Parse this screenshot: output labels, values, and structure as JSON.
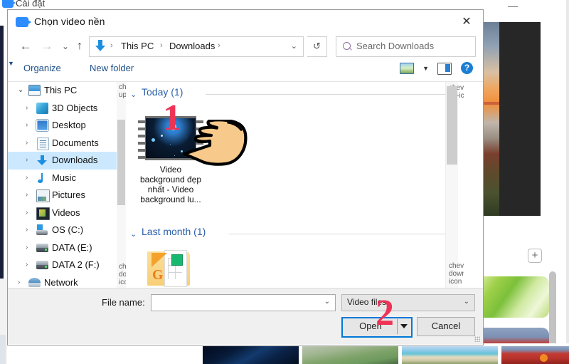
{
  "background_window": {
    "title": "Cài đặt",
    "title_icon": "zoom-video-icon",
    "minimize_label": "—",
    "popout_icon": "popout-icon",
    "add_icon": "plus-icon",
    "thumbnails": [
      {
        "name": "virtual-background-space"
      },
      {
        "name": "virtual-background-aurora"
      },
      {
        "name": "virtual-background-beach"
      },
      {
        "name": "virtual-background-team"
      },
      {
        "name": "virtual-background-grass"
      },
      {
        "name": "virtual-background-soccer-team"
      }
    ]
  },
  "dialog": {
    "title": "Chọn video nền",
    "title_icon": "zoom-video-icon",
    "close_label": "✕",
    "nav": {
      "back_icon": "arrow-left-icon",
      "forward_icon": "arrow-right-icon",
      "recent_icon": "chevron-down-icon",
      "up_icon": "arrow-up-icon",
      "refresh_icon": "refresh-icon",
      "address_icon": "downloads-icon",
      "breadcrumbs": [
        "This PC",
        "Downloads"
      ],
      "breadcrumb_separator": "›",
      "address_chevron": "chevron-down-icon"
    },
    "search": {
      "placeholder": "Search Downloads",
      "value": "",
      "icon": "search-icon"
    },
    "command_bar": {
      "organize_label": "Organize",
      "organize_caret": "▼",
      "new_folder_label": "New folder",
      "view_icon": "view-layout-icon",
      "view_caret": "▼",
      "preview_pane_icon": "preview-pane-icon",
      "help_icon": "help-icon",
      "help_label": "?"
    },
    "tree": {
      "items": [
        {
          "label": "This PC",
          "icon": "computer-icon",
          "indent": 0,
          "arrow": "⌄",
          "expanded": true,
          "selected": false
        },
        {
          "label": "3D Objects",
          "icon": "3d-objects-icon",
          "indent": 1,
          "arrow": "›",
          "expanded": false,
          "selected": false
        },
        {
          "label": "Desktop",
          "icon": "desktop-icon",
          "indent": 1,
          "arrow": "›",
          "expanded": false,
          "selected": false
        },
        {
          "label": "Documents",
          "icon": "documents-icon",
          "indent": 1,
          "arrow": "›",
          "expanded": false,
          "selected": false
        },
        {
          "label": "Downloads",
          "icon": "downloads-icon",
          "indent": 1,
          "arrow": "›",
          "expanded": false,
          "selected": true
        },
        {
          "label": "Music",
          "icon": "music-icon",
          "indent": 1,
          "arrow": "›",
          "expanded": false,
          "selected": false
        },
        {
          "label": "Pictures",
          "icon": "pictures-icon",
          "indent": 1,
          "arrow": "›",
          "expanded": false,
          "selected": false
        },
        {
          "label": "Videos",
          "icon": "videos-icon",
          "indent": 1,
          "arrow": "›",
          "expanded": false,
          "selected": false
        },
        {
          "label": "OS (C:)",
          "icon": "os-drive-icon",
          "indent": 1,
          "arrow": "›",
          "expanded": false,
          "selected": false
        },
        {
          "label": "DATA (E:)",
          "icon": "drive-icon",
          "indent": 1,
          "arrow": "›",
          "expanded": false,
          "selected": false
        },
        {
          "label": "DATA 2 (F:)",
          "icon": "drive-icon",
          "indent": 1,
          "arrow": "›",
          "expanded": false,
          "selected": false
        },
        {
          "label": "Network",
          "icon": "network-icon",
          "indent": 0,
          "arrow": "›",
          "expanded": false,
          "selected": false
        }
      ],
      "scroll_up_icon": "chevron-up-icon",
      "scroll_down_icon": "chevron-down-icon"
    },
    "file_list": {
      "groups": [
        {
          "label": "Today (1)",
          "collapse_icon": "chevron-down-icon",
          "items": [
            {
              "name": "Video background đẹp nhất - Video background lu...",
              "icon": "video-file-icon",
              "line1": "Video",
              "line2": "background đẹp",
              "line3": "nhất - Video",
              "line4": "background lu..."
            }
          ]
        },
        {
          "label": "Last month (1)",
          "collapse_icon": "chevron-down-icon",
          "items": [
            {
              "name": "folder-item",
              "icon": "folder-icon"
            }
          ]
        }
      ],
      "scroll_up_icon": "chevron-up-icon",
      "scroll_down_icon": "chevron-down-icon"
    },
    "footer": {
      "file_name_label": "File name:",
      "file_name_value": "",
      "file_name_chevron": "⌄",
      "file_type_value": "Video files",
      "file_type_chevron": "⌄",
      "open_label": "Open",
      "open_split_icon": "triangle-down-icon",
      "cancel_label": "Cancel",
      "resize_grip": "resize-grip-icon"
    }
  },
  "annotations": [
    {
      "id": "step-1",
      "label": "1",
      "color": "#ee3355"
    },
    {
      "id": "step-2",
      "label": "2",
      "color": "#ee3355"
    }
  ],
  "cursor": {
    "icon": "pointing-hand-icon"
  },
  "colors": {
    "accent": "#0078d7",
    "group_heading": "#2b5faa",
    "command_link": "#1b4f8a",
    "selection": "#cce8ff",
    "annotation": "#ee3355"
  }
}
